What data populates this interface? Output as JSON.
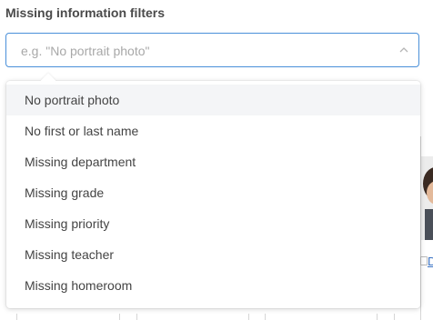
{
  "filter": {
    "label": "Missing information filters",
    "placeholder": "e.g. \"No portrait photo\"",
    "value": ""
  },
  "dropdown": {
    "options": [
      "No portrait photo",
      "No first or last name",
      "Missing department",
      "Missing grade",
      "Missing priority",
      "Missing teacher",
      "Missing homeroom"
    ],
    "highlighted_index": 0
  },
  "background": {
    "link_fragment": "D"
  },
  "colors": {
    "accent": "#4a90d9",
    "option_hover": "#f4f5f7"
  },
  "icons": [
    "chevron-up-icon"
  ]
}
